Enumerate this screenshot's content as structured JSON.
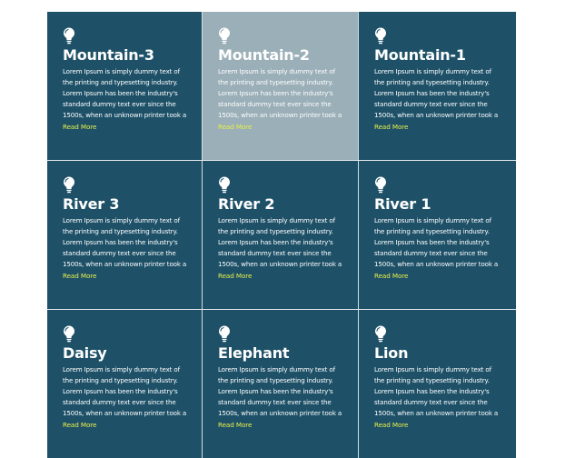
{
  "cards": [
    {
      "title": "Mountain-3",
      "text": "Lorem Ipsum is simply dummy text of the printing and typesetting industry. Lorem Ipsum has been the industry's standard dummy text ever since the 1500s, when an unknown printer took a",
      "link": "Read More"
    },
    {
      "title": "Mountain-2",
      "text": "Lorem Ipsum is simply dummy text of the printing and typesetting industry. Lorem Ipsum has been the industry's standard dummy text ever since the 1500s, when an unknown printer took a",
      "link": "Read More"
    },
    {
      "title": "Mountain-1",
      "text": "Lorem Ipsum is simply dummy text of the printing and typesetting industry. Lorem Ipsum has been the industry's standard dummy text ever since the 1500s, when an unknown printer took a",
      "link": "Read More"
    },
    {
      "title": "River 3",
      "text": "Lorem Ipsum is simply dummy text of the printing and typesetting industry. Lorem Ipsum has been the industry's standard dummy text ever since the 1500s, when an unknown printer took a",
      "link": "Read More"
    },
    {
      "title": "River 2",
      "text": "Lorem Ipsum is simply dummy text of the printing and typesetting industry. Lorem Ipsum has been the industry's standard dummy text ever since the 1500s, when an unknown printer took a",
      "link": "Read More"
    },
    {
      "title": "River 1",
      "text": "Lorem Ipsum is simply dummy text of the printing and typesetting industry. Lorem Ipsum has been the industry's standard dummy text ever since the 1500s, when an unknown printer took a",
      "link": "Read More"
    },
    {
      "title": "Daisy",
      "text": "Lorem Ipsum is simply dummy text of the printing and typesetting industry. Lorem Ipsum has been the industry's standard dummy text ever since the 1500s, when an unknown printer took a",
      "link": "Read More"
    },
    {
      "title": "Elephant",
      "text": "Lorem Ipsum is simply dummy text of the printing and typesetting industry. Lorem Ipsum has been the industry's standard dummy text ever since the 1500s, when an unknown printer took a",
      "link": "Read More"
    },
    {
      "title": "Lion",
      "text": "Lorem Ipsum is simply dummy text of the printing and typesetting industry. Lorem Ipsum has been the industry's standard dummy text ever since the 1500s, when an unknown printer took a",
      "link": "Read More"
    }
  ],
  "icon": "lightbulb-icon",
  "colors": {
    "card_bg": "#1e5168",
    "card_hover_bg": "#9aafb7",
    "link": "#e8f04a",
    "text": "#ffffff"
  }
}
